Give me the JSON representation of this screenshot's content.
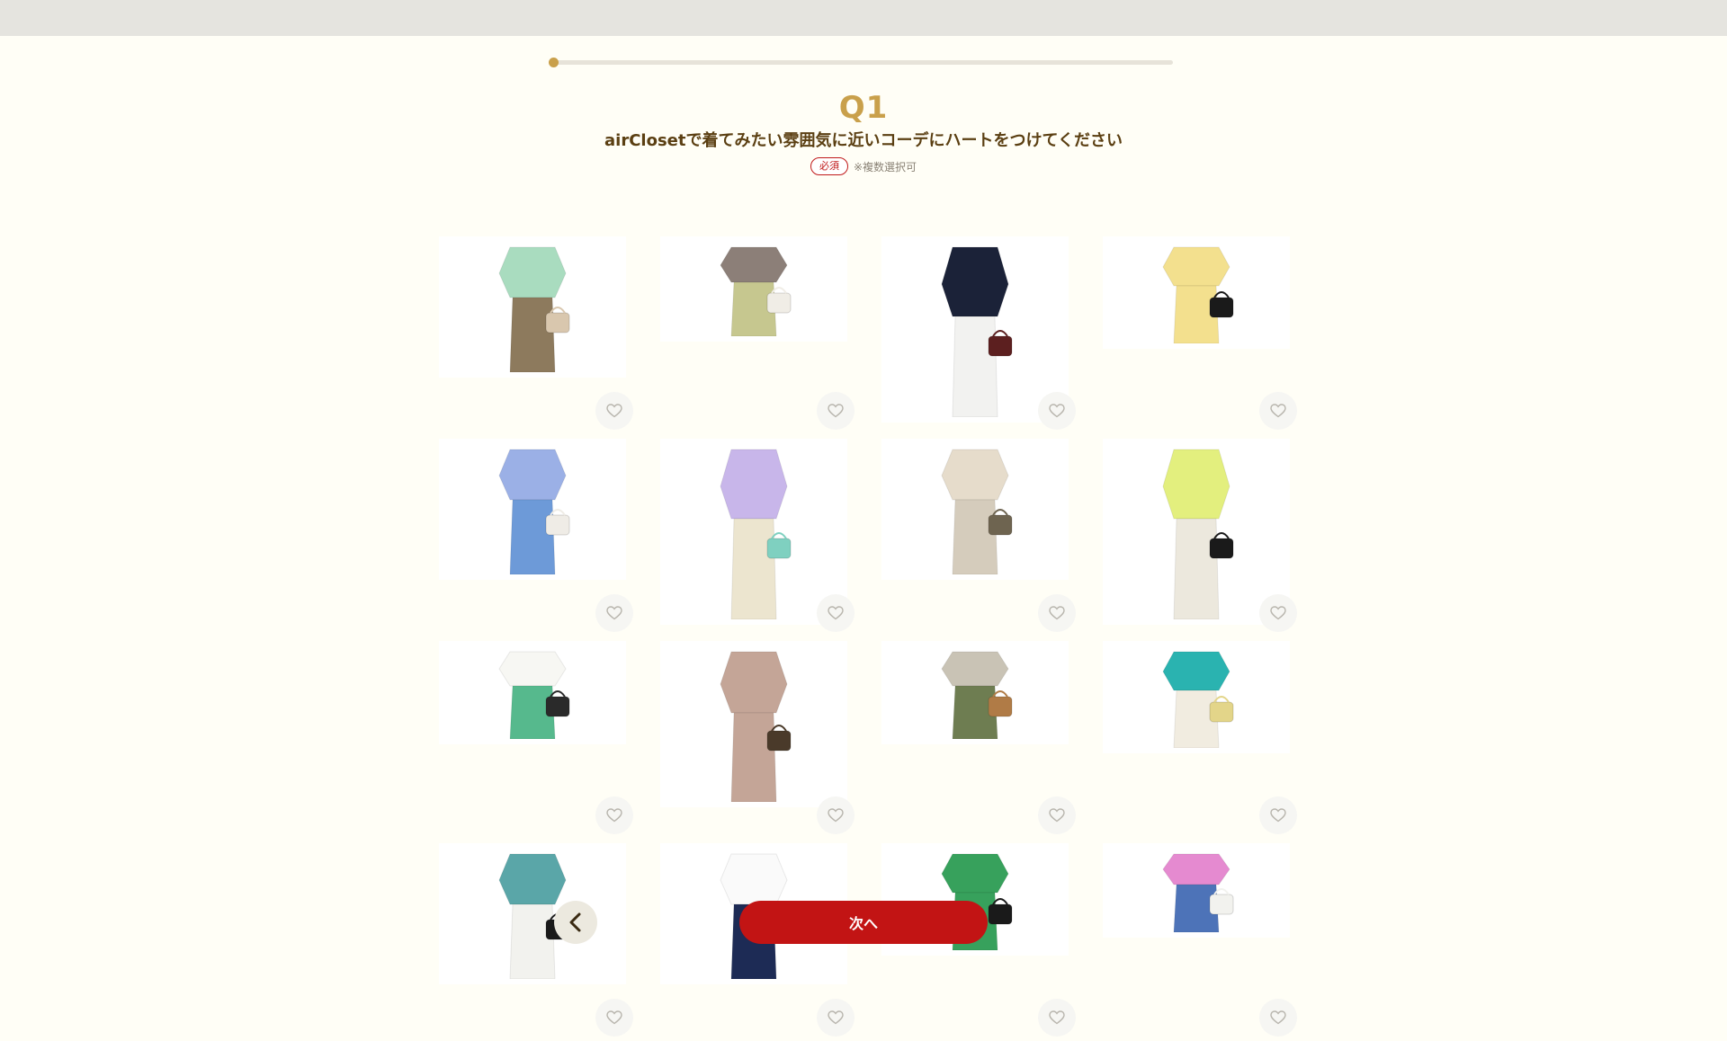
{
  "header": {
    "bar_color": "#e5e4df"
  },
  "progress": {
    "value": 0.01,
    "color": "#c9a04b"
  },
  "question": {
    "number": "Q1",
    "title": "airClosetで着てみたい雰囲気に近いコーデにハートをつけてください",
    "required_label": "必須",
    "note": "※複数選択可"
  },
  "outfits": [
    {
      "top": "#a9dcbf",
      "bottom": "#8d7a5d",
      "bag": "#d9c7ae",
      "liked": false
    },
    {
      "top": "#8c7f78",
      "bottom": "#c6c78f",
      "bag": "#f0ede6",
      "liked": false
    },
    {
      "top": "#1b2238",
      "bottom": "#f2f2f0",
      "bag": "#5c1f1f",
      "liked": false
    },
    {
      "top": "#f3e08e",
      "bottom": "#f3e08e",
      "bag": "#1a1a1a",
      "liked": false
    },
    {
      "top": "#9bb0e6",
      "bottom": "#6d9ad8",
      "bag": "#efece6",
      "liked": false
    },
    {
      "top": "#c8b6ea",
      "bottom": "#ece5cf",
      "bag": "#7fd0c0",
      "liked": false
    },
    {
      "top": "#e6dccb",
      "bottom": "#d5ccbc",
      "bag": "#6e6450",
      "liked": false
    },
    {
      "top": "#e3ef7e",
      "bottom": "#ece8dd",
      "bag": "#1a1a1a",
      "liked": false
    },
    {
      "top": "#f7f7f3",
      "bottom": "#56b98d",
      "bag": "#2a2a2a",
      "liked": false
    },
    {
      "top": "#c4a597",
      "bottom": "#c4a597",
      "bag": "#4a3a2a",
      "liked": false
    },
    {
      "top": "#c9c3b5",
      "bottom": "#6e7d51",
      "bag": "#b07b46",
      "liked": false
    },
    {
      "top": "#2ab3b0",
      "bottom": "#f1ece0",
      "bag": "#e3d589",
      "liked": false
    },
    {
      "top": "#5aa6a8",
      "bottom": "#f2f2ee",
      "bag": "#1a1a1a",
      "liked": false
    },
    {
      "top": "#fafafa",
      "bottom": "#1d2b55",
      "bag": "#1a1a1a",
      "liked": false
    },
    {
      "top": "#37a15c",
      "bottom": "#37a15c",
      "bag": "#1a1a1a",
      "liked": false
    },
    {
      "top": "#e58ad0",
      "bottom": "#4d73b8",
      "bag": "#f2f2ee",
      "liked": false
    }
  ],
  "nav": {
    "back_icon": "chevron-left-icon",
    "next_label": "次へ"
  },
  "colors": {
    "accent": "#c9a04b",
    "primary": "#c21414",
    "title": "#5b3f12"
  }
}
